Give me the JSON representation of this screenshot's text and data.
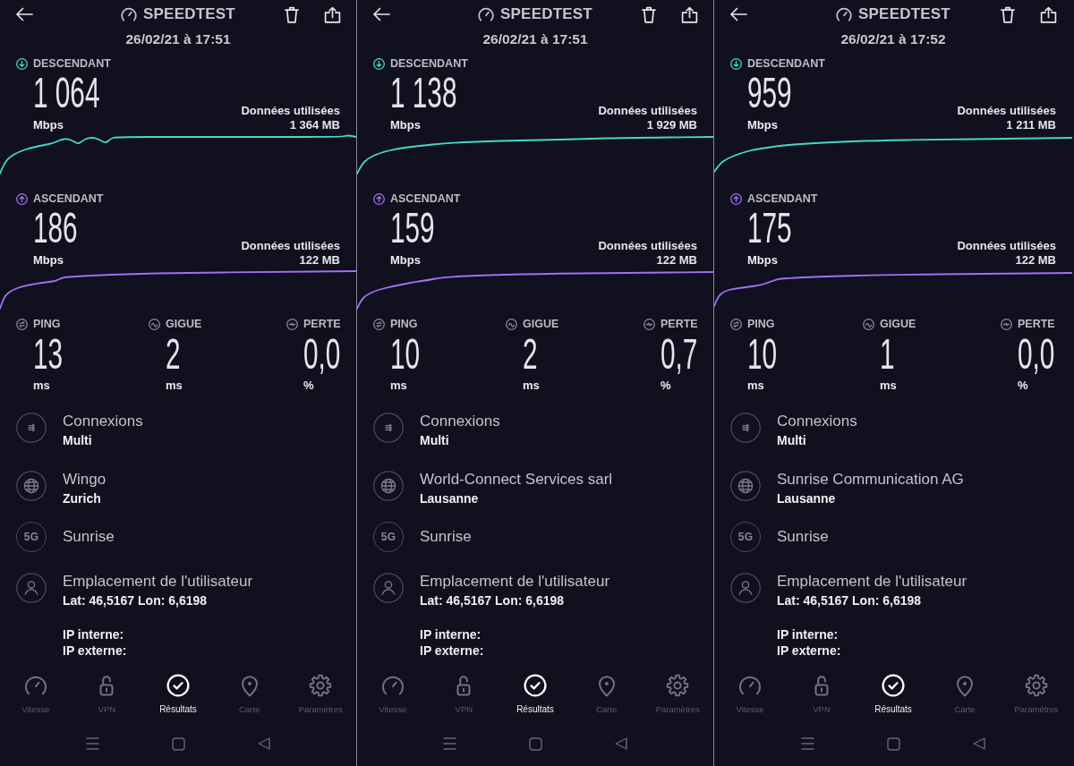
{
  "screens": [
    {
      "header": {
        "title": "SPEEDTEST",
        "date": "26/02/21 à 17:51"
      },
      "speeds": [
        {
          "kind": "download",
          "label": "DESCENDANT",
          "value": "1 064",
          "unit": "Mbps",
          "data_label": "Données utilisées",
          "data_amount": "1 364 MB"
        },
        {
          "kind": "upload",
          "label": "ASCENDANT",
          "value": "186",
          "unit": "Mbps",
          "data_label": "Données utilisées",
          "data_amount": "122 MB"
        }
      ],
      "latency": [
        {
          "kind": "ping",
          "label": "PING",
          "value": "13",
          "unit": "ms"
        },
        {
          "kind": "jitter",
          "label": "GIGUE",
          "value": "2",
          "unit": "ms"
        },
        {
          "kind": "loss",
          "label": "PERTE",
          "value": "0,0",
          "unit": "%"
        }
      ],
      "details": [
        {
          "kind": "connections",
          "title": "Connexions",
          "subtitle": "Multi"
        },
        {
          "kind": "server",
          "title": "Wingo",
          "subtitle": "Zurich"
        },
        {
          "kind": "network",
          "badge": "5G",
          "title": "Sunrise"
        },
        {
          "kind": "location",
          "title": "Emplacement de l'utilisateur",
          "subtitle": "Lat: 46,5167 Lon: 6,6198"
        }
      ],
      "ip_lines": [
        "IP interne:",
        "IP externe:"
      ],
      "tabs": [
        {
          "label": "Vitesse",
          "selected": false
        },
        {
          "label": "VPN",
          "selected": false
        },
        {
          "label": "Résultats",
          "selected": true
        },
        {
          "label": "Carte",
          "selected": false
        },
        {
          "label": "Paramètres",
          "selected": false
        }
      ]
    },
    {
      "header": {
        "title": "SPEEDTEST",
        "date": "26/02/21 à 17:51"
      },
      "speeds": [
        {
          "kind": "download",
          "label": "DESCENDANT",
          "value": "1 138",
          "unit": "Mbps",
          "data_label": "Données utilisées",
          "data_amount": "1 929 MB"
        },
        {
          "kind": "upload",
          "label": "ASCENDANT",
          "value": "159",
          "unit": "Mbps",
          "data_label": "Données utilisées",
          "data_amount": "122 MB"
        }
      ],
      "latency": [
        {
          "kind": "ping",
          "label": "PING",
          "value": "10",
          "unit": "ms"
        },
        {
          "kind": "jitter",
          "label": "GIGUE",
          "value": "2",
          "unit": "ms"
        },
        {
          "kind": "loss",
          "label": "PERTE",
          "value": "0,7",
          "unit": "%"
        }
      ],
      "details": [
        {
          "kind": "connections",
          "title": "Connexions",
          "subtitle": "Multi"
        },
        {
          "kind": "server",
          "title": "World-Connect Services sarl",
          "subtitle": "Lausanne"
        },
        {
          "kind": "network",
          "badge": "5G",
          "title": "Sunrise"
        },
        {
          "kind": "location",
          "title": "Emplacement de l'utilisateur",
          "subtitle": "Lat: 46,5167 Lon: 6,6198"
        }
      ],
      "ip_lines": [
        "IP interne:",
        "IP externe:"
      ],
      "tabs": [
        {
          "label": "Vitesse",
          "selected": false
        },
        {
          "label": "VPN",
          "selected": false
        },
        {
          "label": "Résultats",
          "selected": true
        },
        {
          "label": "Carte",
          "selected": false
        },
        {
          "label": "Paramètres",
          "selected": false
        }
      ]
    },
    {
      "header": {
        "title": "SPEEDTEST",
        "date": "26/02/21 à 17:52"
      },
      "speeds": [
        {
          "kind": "download",
          "label": "DESCENDANT",
          "value": "959",
          "unit": "Mbps",
          "data_label": "Données utilisées",
          "data_amount": "1 211 MB"
        },
        {
          "kind": "upload",
          "label": "ASCENDANT",
          "value": "175",
          "unit": "Mbps",
          "data_label": "Données utilisées",
          "data_amount": "122 MB"
        }
      ],
      "latency": [
        {
          "kind": "ping",
          "label": "PING",
          "value": "10",
          "unit": "ms"
        },
        {
          "kind": "jitter",
          "label": "GIGUE",
          "value": "1",
          "unit": "ms"
        },
        {
          "kind": "loss",
          "label": "PERTE",
          "value": "0,0",
          "unit": "%"
        }
      ],
      "details": [
        {
          "kind": "connections",
          "title": "Connexions",
          "subtitle": "Multi"
        },
        {
          "kind": "server",
          "title": "Sunrise Communication AG",
          "subtitle": "Lausanne"
        },
        {
          "kind": "network",
          "badge": "5G",
          "title": "Sunrise"
        },
        {
          "kind": "location",
          "title": "Emplacement de l'utilisateur",
          "subtitle": "Lat: 46,5167 Lon: 6,6198"
        }
      ],
      "ip_lines": [
        "IP interne:",
        "IP externe:"
      ],
      "tabs": [
        {
          "label": "Vitesse",
          "selected": false
        },
        {
          "label": "VPN",
          "selected": false
        },
        {
          "label": "Résultats",
          "selected": true
        },
        {
          "label": "Carte",
          "selected": false
        },
        {
          "label": "Paramètres",
          "selected": false
        }
      ]
    }
  ]
}
